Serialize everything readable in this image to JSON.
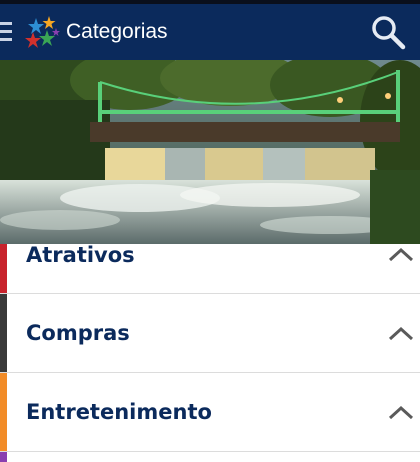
{
  "appbar": {
    "title": "Categorias",
    "menu_icon": "hamburger-menu-icon",
    "logo_icon": "colorful-stars-logo",
    "search_icon": "magnifier-search-icon"
  },
  "hero": {
    "image": "waterfall-and-suspension-bridge-photo"
  },
  "categories": [
    {
      "label": "Atrativos",
      "color": "#c8232c",
      "icon": "chevron-up-icon"
    },
    {
      "label": "Compras",
      "color": "#3a3a3a",
      "icon": "chevron-up-icon"
    },
    {
      "label": "Entretenimento",
      "color": "#f28c28",
      "icon": "chevron-up-icon"
    },
    {
      "label": "",
      "color": "#8a3fb0"
    }
  ],
  "colors": {
    "appbar": "#0b2a5c",
    "label": "#0b2a5c"
  }
}
